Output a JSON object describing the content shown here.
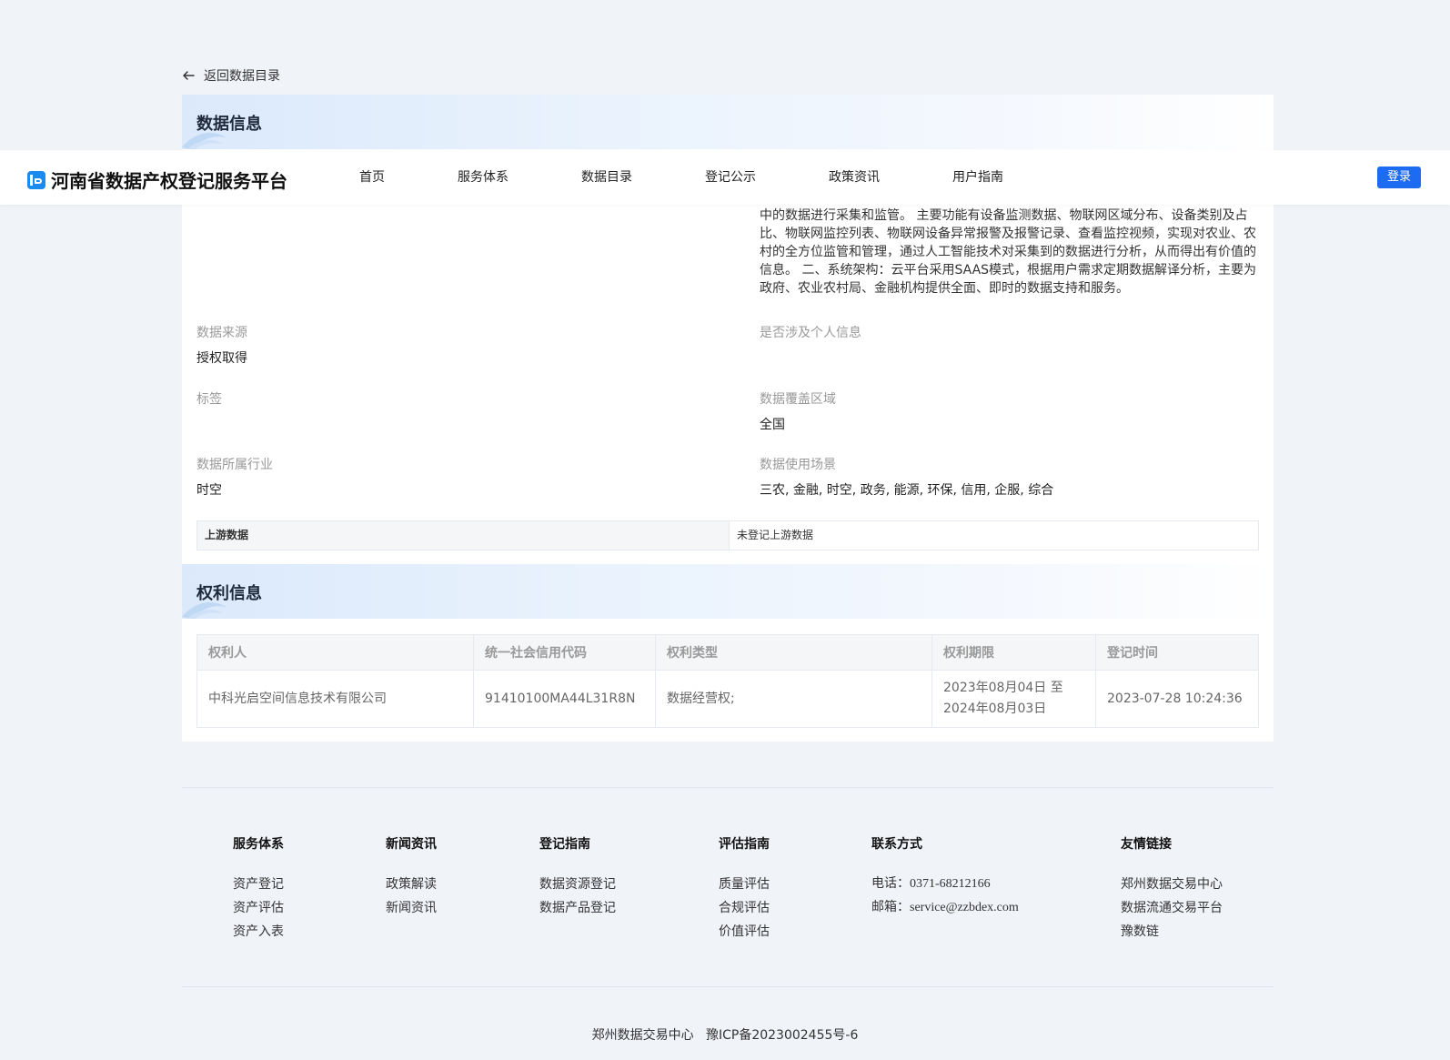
{
  "back_link": {
    "label": "返回数据目录"
  },
  "navbar": {
    "brand": "河南省数据产权登记服务平台",
    "items": [
      "首页",
      "服务体系",
      "数据目录",
      "登记公示",
      "政策资讯",
      "用户指南"
    ],
    "login": "登录"
  },
  "data_info": {
    "title": "数据信息",
    "description": "中的数据进行采集和监管。 主要功能有设备监测数据、物联网区域分布、设备类别及占比、物联网监控列表、物联网设备异常报警及报警记录、查看监控视频，实现对农业、农村的全方位监管和管理，通过人工智能技术对采集到的数据进行分析，从而得出有价值的信息。 二、系统架构：云平台采用SAAS模式，根据用户需求定期数据解译分析，主要为政府、农业农村局、金融机构提供全面、即时的数据支持和服务。",
    "fields": [
      {
        "label": "数据来源",
        "value": "授权取得"
      },
      {
        "label": "是否涉及个人信息",
        "value": ""
      },
      {
        "label": "标签",
        "value": ""
      },
      {
        "label": "数据覆盖区域",
        "value": "全国"
      },
      {
        "label": "数据所属行业",
        "value": "时空"
      },
      {
        "label": "数据使用场景",
        "value": "三农, 金融, 时空, 政务, 能源, 环保, 信用, 企服, 综合"
      }
    ],
    "upstream_label": "上游数据",
    "upstream_value": "未登记上游数据"
  },
  "rights_info": {
    "title": "权利信息",
    "headers": [
      "权利人",
      "统一社会信用代码",
      "权利类型",
      "权利期限",
      "登记时间"
    ],
    "row": {
      "holder": "中科光启空间信息技术有限公司",
      "credit_code": "91410100MA44L31R8N",
      "type": "数据经营权;",
      "term_start": "2023年08月04日 至",
      "term_end": "2024年08月03日",
      "reg_time": "2023-07-28 10:24:36"
    }
  },
  "footer": {
    "columns": [
      {
        "title": "服务体系",
        "links": [
          "资产登记",
          "资产评估",
          "资产入表"
        ]
      },
      {
        "title": "新闻资讯",
        "links": [
          "政策解读",
          "新闻资讯"
        ]
      },
      {
        "title": "登记指南",
        "links": [
          "数据资源登记",
          "数据产品登记"
        ]
      },
      {
        "title": "评估指南",
        "links": [
          "质量评估",
          "合规评估",
          "价值评估"
        ]
      },
      {
        "title": "联系方式",
        "links": [
          "电话：0371-68212166",
          "邮箱：service@zzbdex.com"
        ]
      },
      {
        "title": "友情链接",
        "links": [
          "郑州数据交易中心",
          "数据流通交易平台",
          "豫数链"
        ]
      }
    ],
    "copyright_org": "郑州数据交易中心",
    "icp": "豫ICP备2023002455号-6"
  },
  "colors": {
    "accent": "#1c6bf0",
    "page_bg": "#f0f3f8"
  }
}
